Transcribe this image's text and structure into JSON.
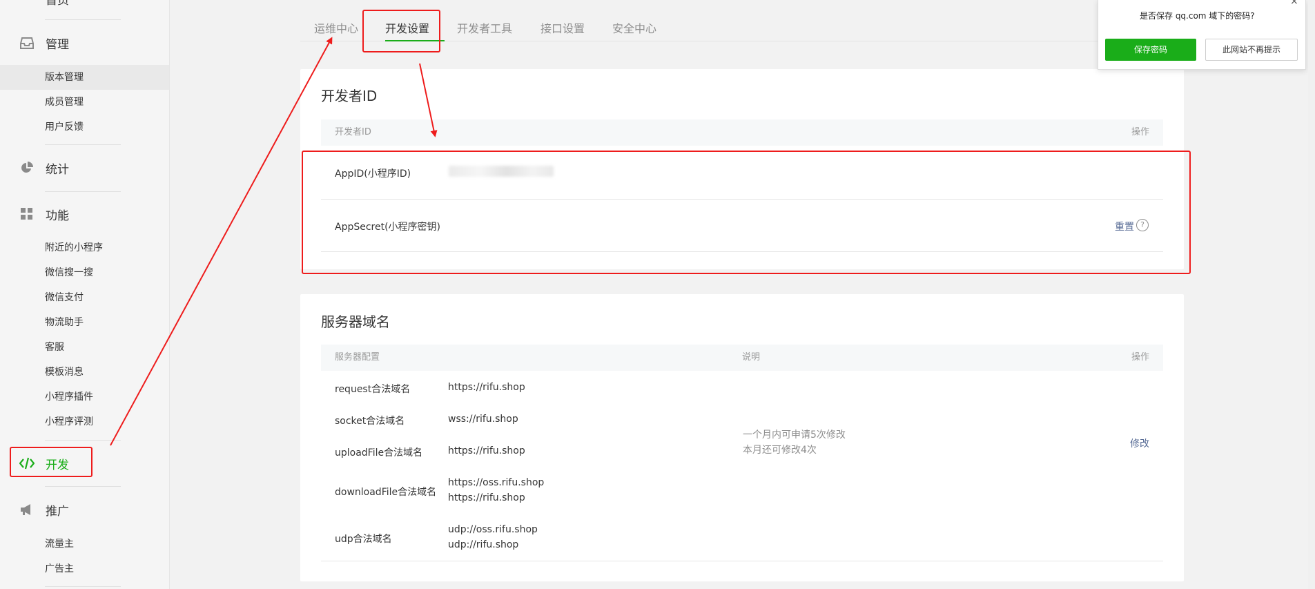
{
  "sidebar": {
    "top_label": "首页",
    "sections": [
      {
        "title": "管理",
        "icon": "inbox-icon",
        "items": [
          "版本管理",
          "成员管理",
          "用户反馈"
        ]
      },
      {
        "title": "统计",
        "icon": "pie-chart-icon",
        "items": []
      },
      {
        "title": "功能",
        "icon": "grid-icon",
        "items": [
          "附近的小程序",
          "微信搜一搜",
          "微信支付",
          "物流助手",
          "客服",
          "模板消息",
          "小程序插件",
          "小程序评测"
        ]
      },
      {
        "title": "开发",
        "icon": "code-icon",
        "items": []
      },
      {
        "title": "推广",
        "icon": "megaphone-icon",
        "items": [
          "流量主",
          "广告主"
        ]
      }
    ]
  },
  "tabs": [
    "运维中心",
    "开发设置",
    "开发者工具",
    "接口设置",
    "安全中心"
  ],
  "developer_id": {
    "title": "开发者ID",
    "col_left": "开发者ID",
    "col_right": "操作",
    "appid_label": "AppID(小程序ID)",
    "secret_label": "AppSecret(小程序密钥)",
    "reset_label": "重置",
    "help_glyph": "?"
  },
  "server": {
    "title": "服务器域名",
    "col1": "服务器配置",
    "col2": "说明",
    "col3": "操作",
    "rows": [
      {
        "label": "request合法域名",
        "values": [
          "https://rifu.shop"
        ]
      },
      {
        "label": "socket合法域名",
        "values": [
          "wss://rifu.shop"
        ]
      },
      {
        "label": "uploadFile合法域名",
        "values": [
          "https://rifu.shop"
        ]
      },
      {
        "label": "downloadFile合法域名",
        "values": [
          "https://oss.rifu.shop",
          "https://rifu.shop"
        ]
      },
      {
        "label": "udp合法域名",
        "values": [
          "udp://oss.rifu.shop",
          "udp://rifu.shop"
        ]
      }
    ],
    "note_line1": "一个月内可申请5次修改",
    "note_line2": "本月还可修改4次",
    "modify_label": "修改"
  },
  "popup": {
    "question": "是否保存 qq.com 域下的密码?",
    "save_label": "保存密码",
    "never_label": "此网站不再提示",
    "close_glyph": "×"
  },
  "colors": {
    "accent": "#1aad19",
    "link": "#576b95",
    "annotation": "#ee1c1c"
  }
}
